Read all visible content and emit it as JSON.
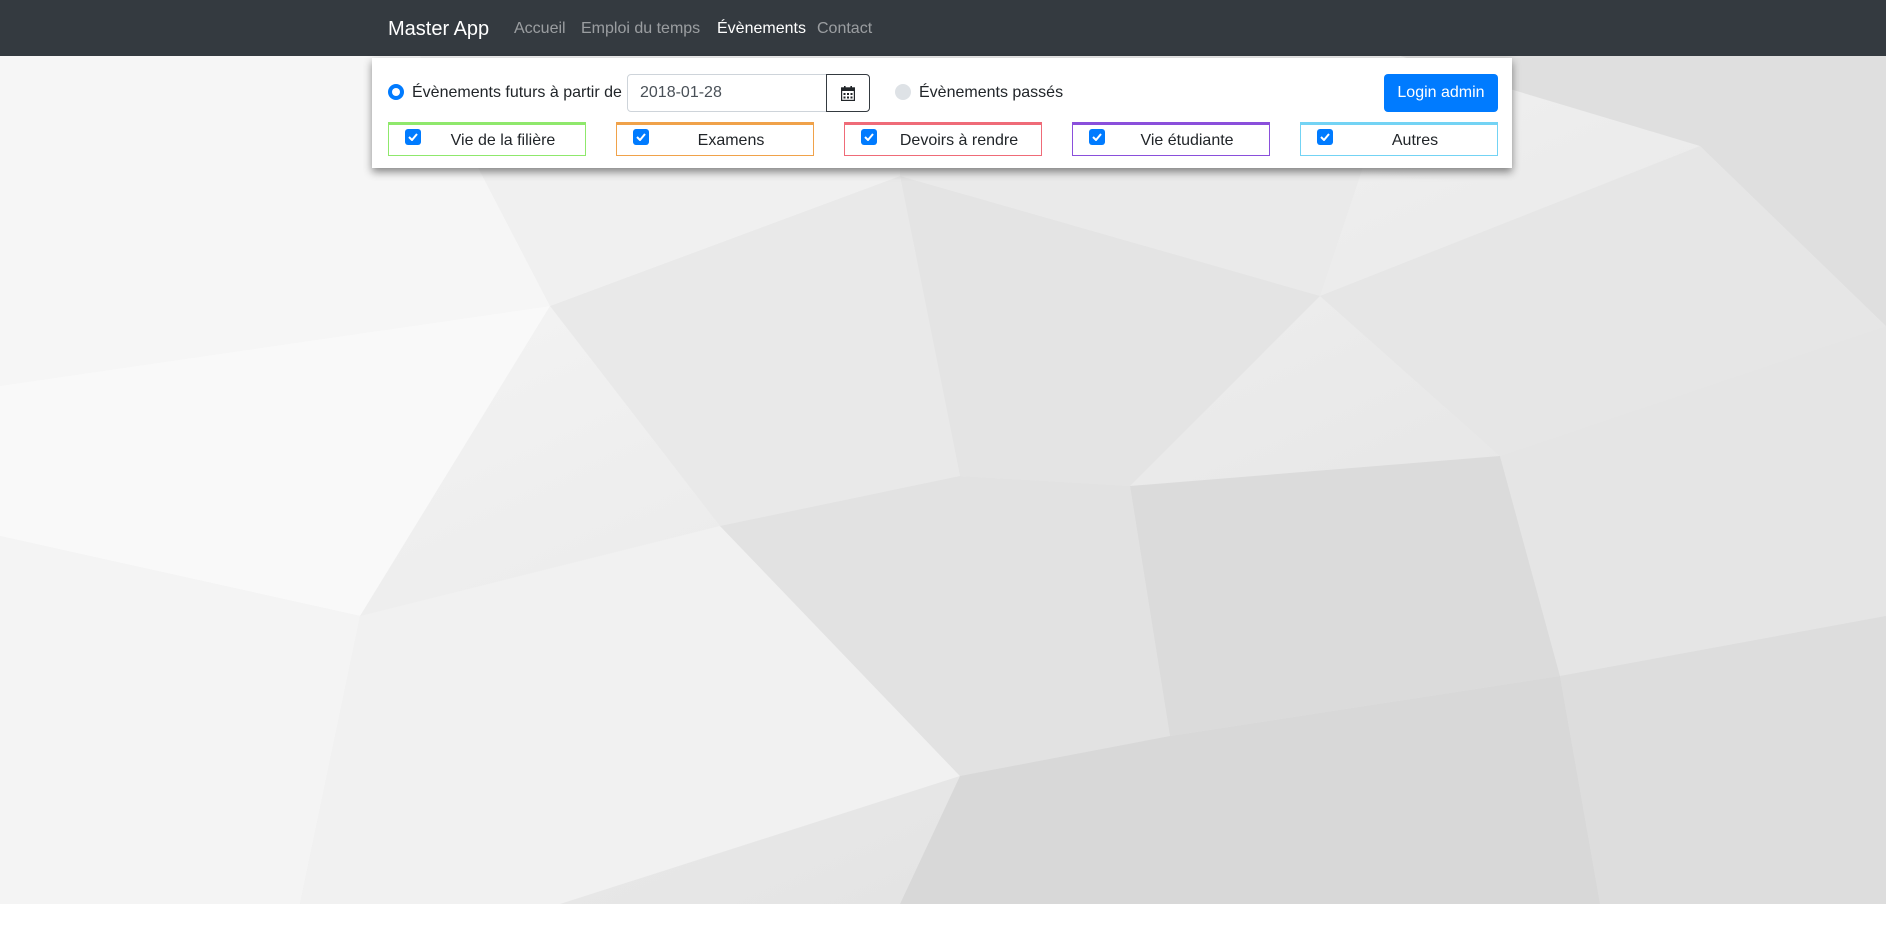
{
  "navbar": {
    "brand": "Master App",
    "links": [
      {
        "label": "Accueil",
        "active": false
      },
      {
        "label": "Emploi du temps",
        "active": false
      },
      {
        "label": "Évènements",
        "active": true
      },
      {
        "label": "Contact",
        "active": false
      }
    ]
  },
  "events_filter": {
    "future_label": "Évènements futurs à partir de",
    "future_selected": true,
    "date_value": "2018-01-28",
    "calendar_icon": "calendar-icon",
    "past_label": "Évènements passés",
    "past_selected": false,
    "login_button": "Login admin",
    "categories": [
      {
        "label": "Vie de la filière",
        "checked": true,
        "color": "#8fe86c"
      },
      {
        "label": "Examens",
        "checked": true,
        "color": "#f0a24a"
      },
      {
        "label": "Devoirs à rendre",
        "checked": true,
        "color": "#ef6b78"
      },
      {
        "label": "Vie étudiante",
        "checked": true,
        "color": "#8a4fdb"
      },
      {
        "label": "Autres",
        "checked": true,
        "color": "#73d3f4"
      }
    ]
  },
  "colors": {
    "navbar": "#343a40",
    "primary": "#007bff"
  }
}
